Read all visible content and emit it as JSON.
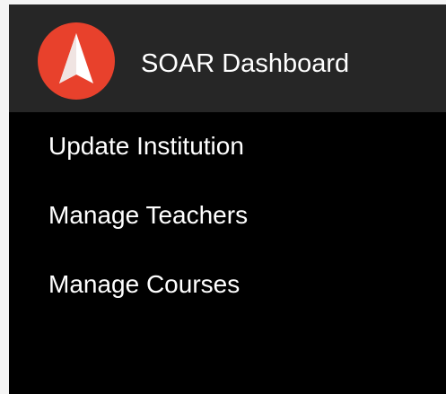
{
  "app": {
    "title": "SOAR Dashboard",
    "logo_icon": "soar-arrow-logo-icon",
    "brand_color": "#e8412c"
  },
  "menu": {
    "items": [
      {
        "label": "Update Institution"
      },
      {
        "label": "Manage Teachers"
      },
      {
        "label": "Manage Courses"
      }
    ]
  }
}
